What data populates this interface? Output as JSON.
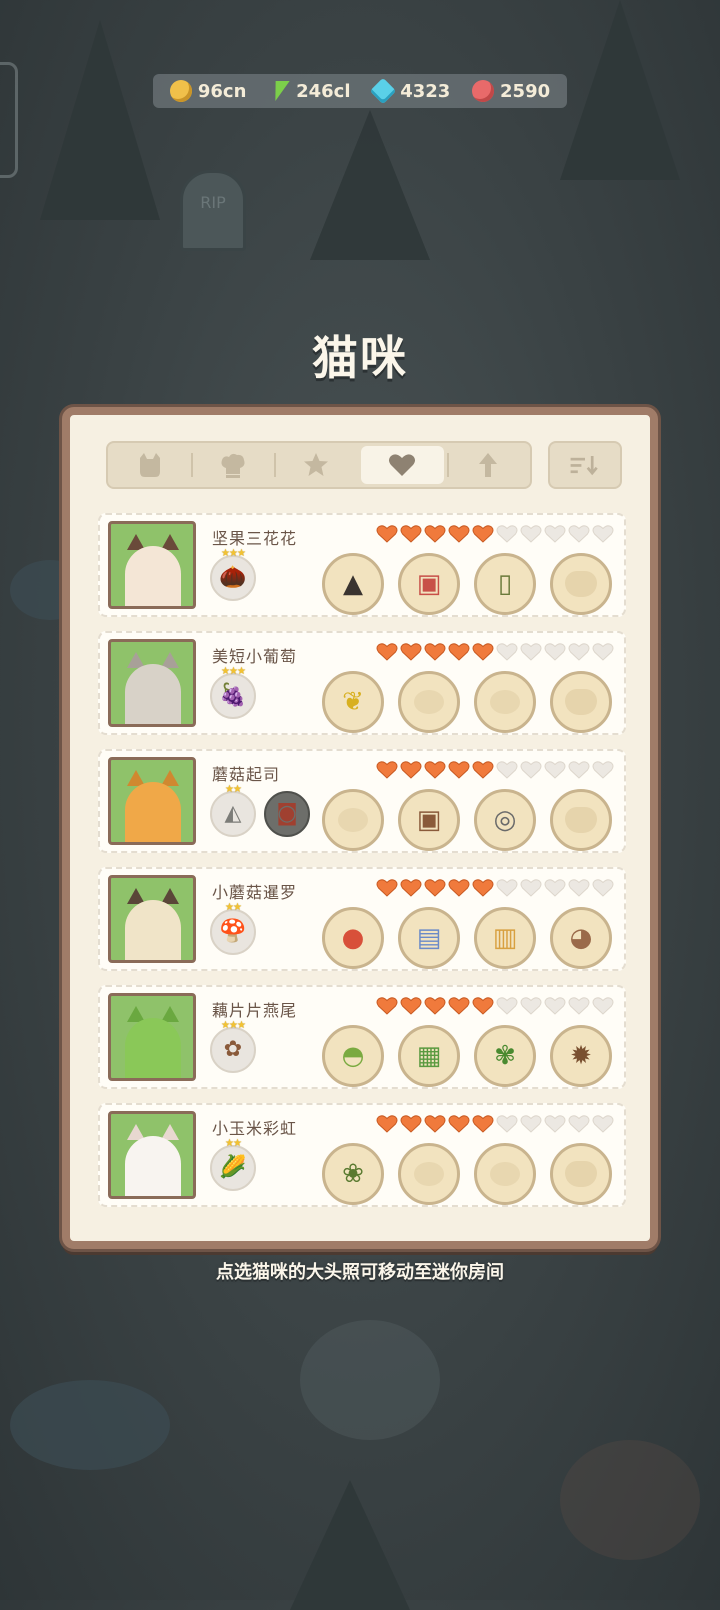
{
  "currency": [
    {
      "icon": "coin-icon",
      "value": "96cn"
    },
    {
      "icon": "energy-icon",
      "value": "246cl"
    },
    {
      "icon": "gem-icon",
      "value": "4323"
    },
    {
      "icon": "can-icon",
      "value": "2590"
    }
  ],
  "title": "猫咪",
  "tabs": [
    {
      "icon": "cat-icon",
      "active": false
    },
    {
      "icon": "chef-hat-icon",
      "active": false
    },
    {
      "icon": "star-icon",
      "active": false
    },
    {
      "icon": "heart-icon",
      "active": true
    },
    {
      "icon": "arrow-up-icon",
      "active": false
    }
  ],
  "sort_icon": "sort-icon",
  "hearts_total": 10,
  "cats": [
    {
      "name": "坚果三花花",
      "hearts": 5,
      "traits": [
        {
          "icon": "acorn-icon",
          "stars": 3
        }
      ],
      "items": [
        "witch-hat-icon",
        "red-vest-icon",
        "book-icon",
        "empty-slot-icon"
      ]
    },
    {
      "name": "美短小葡萄",
      "hearts": 5,
      "traits": [
        {
          "icon": "grape-icon",
          "stars": 3
        }
      ],
      "items": [
        "leaf-crown-icon",
        "empty-shirt-icon",
        "empty-glasses-icon",
        "empty-slot-icon"
      ]
    },
    {
      "name": "蘑菇起司",
      "hearts": 5,
      "traits": [
        {
          "icon": "cheese-icon",
          "stars": 2
        },
        {
          "icon": "jar-icon",
          "stars": 0
        }
      ],
      "items": [
        "empty-hat-icon",
        "brown-vest-icon",
        "monocle-icon",
        "empty-slot-icon"
      ]
    },
    {
      "name": "小蘑菇暹罗",
      "hearts": 5,
      "traits": [
        {
          "icon": "mushroom-icon",
          "stars": 2
        }
      ],
      "items": [
        "berry-icon",
        "blue-dress-icon",
        "bubble-tea-icon",
        "capybara-icon"
      ]
    },
    {
      "name": "藕片片燕尾",
      "hearts": 5,
      "traits": [
        {
          "icon": "lotus-root-icon",
          "stars": 3
        }
      ],
      "items": [
        "frog-hood-icon",
        "green-coat-icon",
        "lotus-leaf-icon",
        "hedgehog-icon"
      ]
    },
    {
      "name": "小玉米彩虹",
      "hearts": 5,
      "traits": [
        {
          "icon": "corn-icon",
          "stars": 2
        }
      ],
      "items": [
        "flower-wreath-icon",
        "empty-shirt-icon",
        "empty-glasses-icon",
        "empty-slot-icon"
      ]
    }
  ],
  "hint": "点选猫咪的大头照可移动至迷你房间",
  "colors": {
    "heart_full": "#f07a3c",
    "heart_empty": "#ece8e2",
    "panel_border": "#a07c68"
  }
}
